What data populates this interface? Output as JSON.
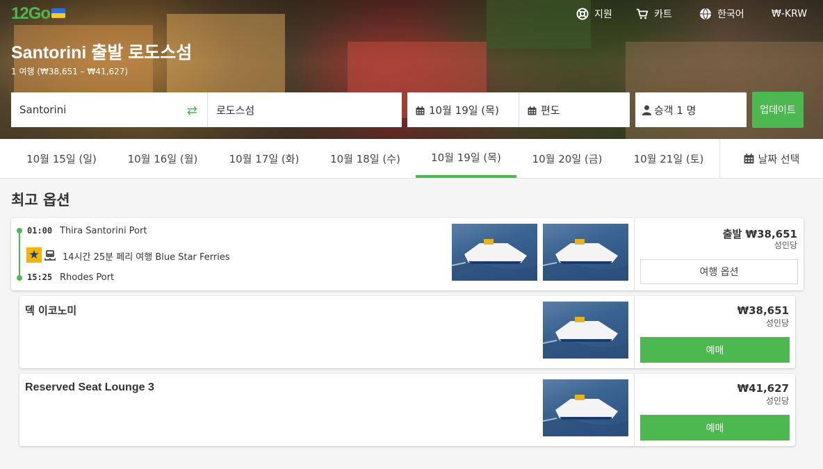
{
  "brand": {
    "logo": "12Go",
    "accent": "#4cb84f"
  },
  "header": {
    "support": "지원",
    "cart": "카트",
    "language": "한국어",
    "currency": "₩-KRW"
  },
  "route": {
    "title": "Santorini 출발 로도스섬",
    "subtitle": "1 여행 (₩38,651 – ₩41,627)"
  },
  "search": {
    "from": "Santorini",
    "to": "로도스섬",
    "date": "10월 19일 (목)",
    "return": "편도",
    "passengers": "승객 1 명",
    "update": "업데이트"
  },
  "date_tabs": [
    {
      "label": "10월 15일 (일)",
      "active": false
    },
    {
      "label": "10월 16일 (월)",
      "active": false
    },
    {
      "label": "10월 17일 (화)",
      "active": false
    },
    {
      "label": "10월 18일 (수)",
      "active": false
    },
    {
      "label": "10월 19일 (목)",
      "active": true
    },
    {
      "label": "10월 20일 (금)",
      "active": false
    },
    {
      "label": "10월 21일 (토)",
      "active": false
    }
  ],
  "date_picker": "날짜 선택",
  "results": {
    "section_title": "최고 옵션",
    "trip": {
      "depart_time": "01:00",
      "depart_port": "Thira Santorini Port",
      "arrive_time": "15:25",
      "arrive_port": "Rhodes Port",
      "description": "14시간 25분 페리 여행 Blue Star Ferries",
      "price": "출발 ₩38,651",
      "per_person": "성인당",
      "options_button": "여행 옵션"
    },
    "classes": [
      {
        "name": "덱 이코노미",
        "price": "₩38,651",
        "per_person": "성인당",
        "book": "예매"
      },
      {
        "name": "Reserved Seat Lounge 3",
        "price": "₩41,627",
        "per_person": "성인당",
        "book": "예매"
      }
    ]
  }
}
